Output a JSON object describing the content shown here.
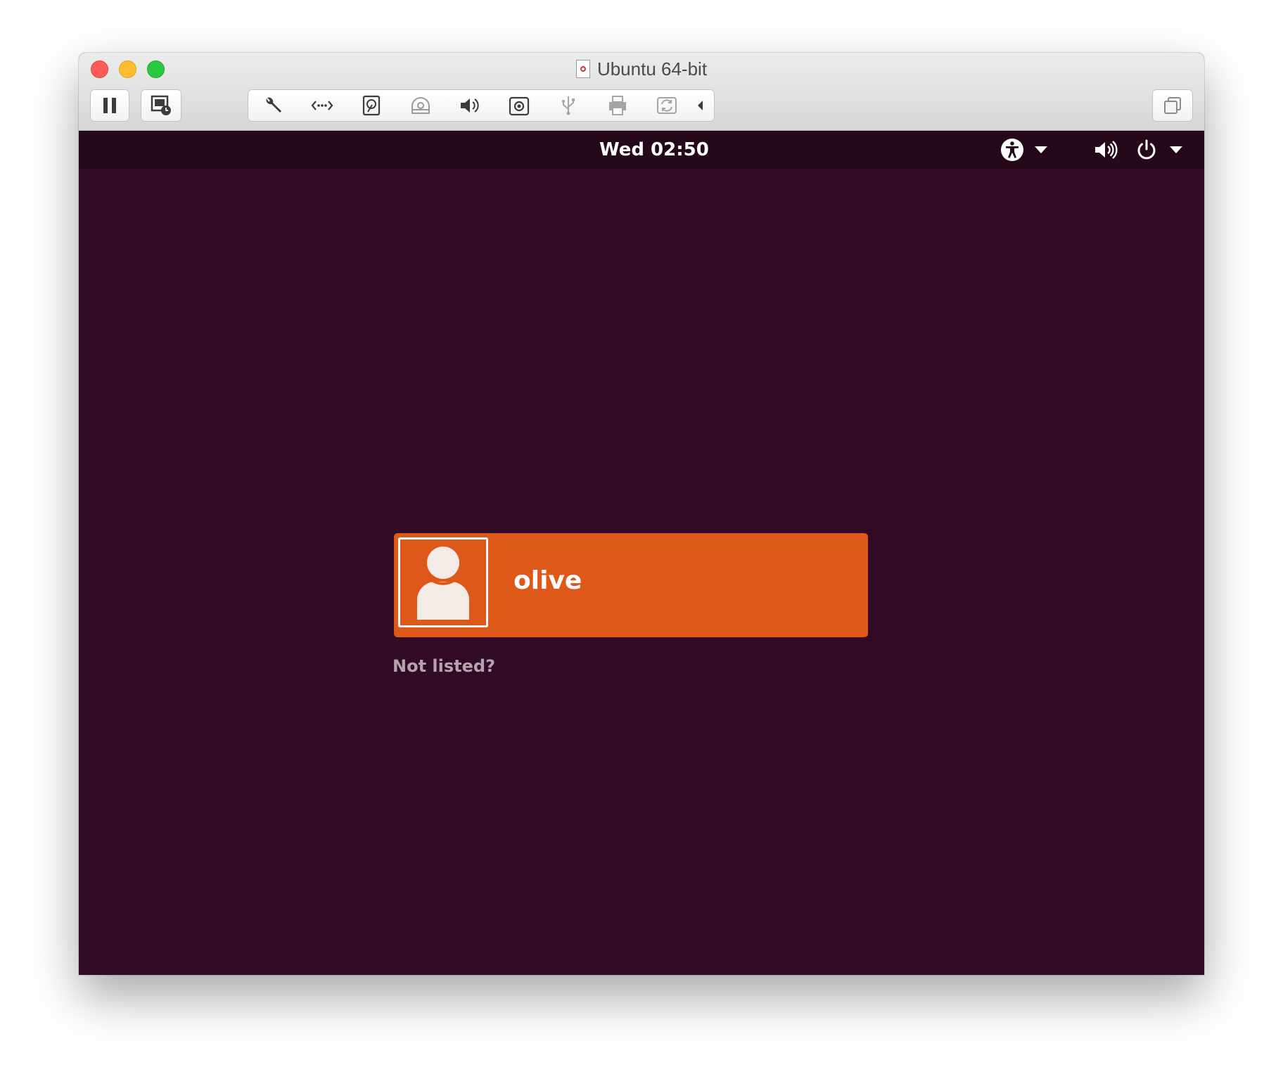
{
  "window": {
    "title": "Ubuntu 64-bit"
  },
  "toolbar": {
    "left_buttons": [
      "pause-icon",
      "snapshot-icon"
    ],
    "device_icons": [
      "wrench-icon",
      "network-icon",
      "hard-disk-icon",
      "optical-drive-icon",
      "speaker-icon",
      "camera-icon",
      "usb-icon",
      "printer-icon",
      "sync-icon"
    ],
    "right_button": "windows-icon"
  },
  "gnome": {
    "clock": "Wed 02:50",
    "tray": [
      "accessibility-icon",
      "volume-icon",
      "power-icon"
    ]
  },
  "login": {
    "user_name": "olive",
    "not_listed": "Not listed?"
  },
  "colors": {
    "background": "#300a24",
    "topbar": "#250819",
    "user_card": "#dd5819",
    "not_listed_text": "#b5a3ad"
  }
}
